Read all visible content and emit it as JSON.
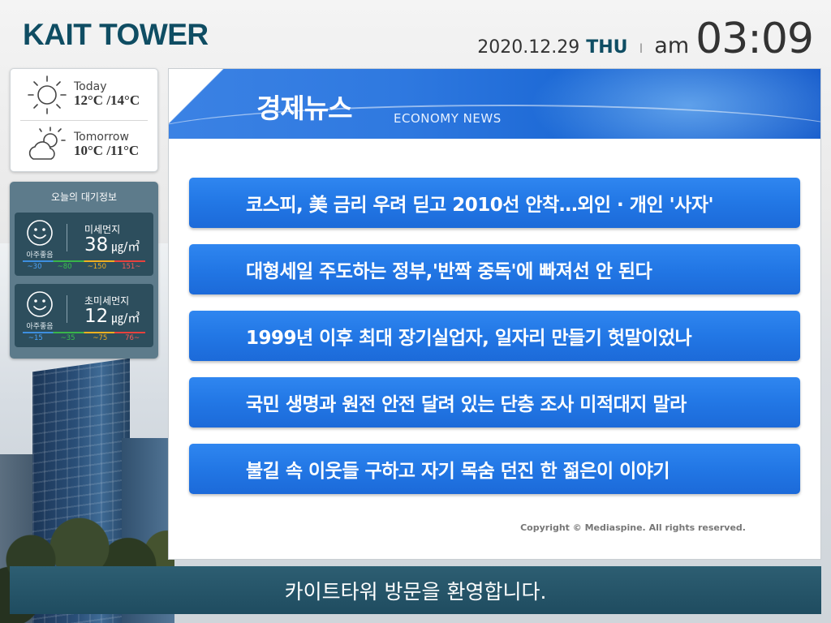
{
  "header": {
    "brand": "KAIT TOWER",
    "date": "2020.12.29",
    "day_of_week": "THU",
    "separator": "I",
    "ampm": "am",
    "time": "03:09"
  },
  "weather": {
    "today": {
      "label": "Today",
      "temp": "12°C /14°C",
      "icon": "sun-icon"
    },
    "tomorrow": {
      "label": "Tomorrow",
      "temp": "10°C /11°C",
      "icon": "cloud-sun-icon"
    }
  },
  "air_quality": {
    "title": "오늘의 대기정보",
    "pm10": {
      "name": "미세먼지",
      "value": "38",
      "unit": "㎍/㎥",
      "grade": "아주좋음",
      "scale": [
        "~30",
        "~80",
        "~150",
        "151~"
      ]
    },
    "pm25": {
      "name": "초미세먼지",
      "value": "12",
      "unit": "㎍/㎥",
      "grade": "아주좋음",
      "scale": [
        "~15",
        "~35",
        "~75",
        "76~"
      ]
    },
    "scale_colors": [
      "#4aa3ff",
      "#39c24d",
      "#f2b01e",
      "#ff5a55"
    ]
  },
  "news": {
    "title": "경제뉴스",
    "subtitle": "ECONOMY  NEWS",
    "items": [
      "코스피, 美 금리 우려 딛고 2010선 안착…외인 ·  개인 '사자'",
      "대형세일 주도하는 정부,'반짝 중독'에 빠져선 안 된다",
      "1999년 이후 최대 장기실업자, 일자리 만들기 헛말이었나",
      "국민 생명과 원전 안전 달려 있는 단층 조사 미적대지 말라",
      "불길 속 이웃들 구하고 자기 목숨 던진 한 젊은이 이야기"
    ],
    "copyright": "Copyright ©   Mediaspine.   All rights reserved."
  },
  "footer": {
    "message": "카이트타워 방문을 환영합니다."
  },
  "colors": {
    "brand": "#0f4d63",
    "news_button": "#2277e5",
    "footer": "#245468"
  }
}
